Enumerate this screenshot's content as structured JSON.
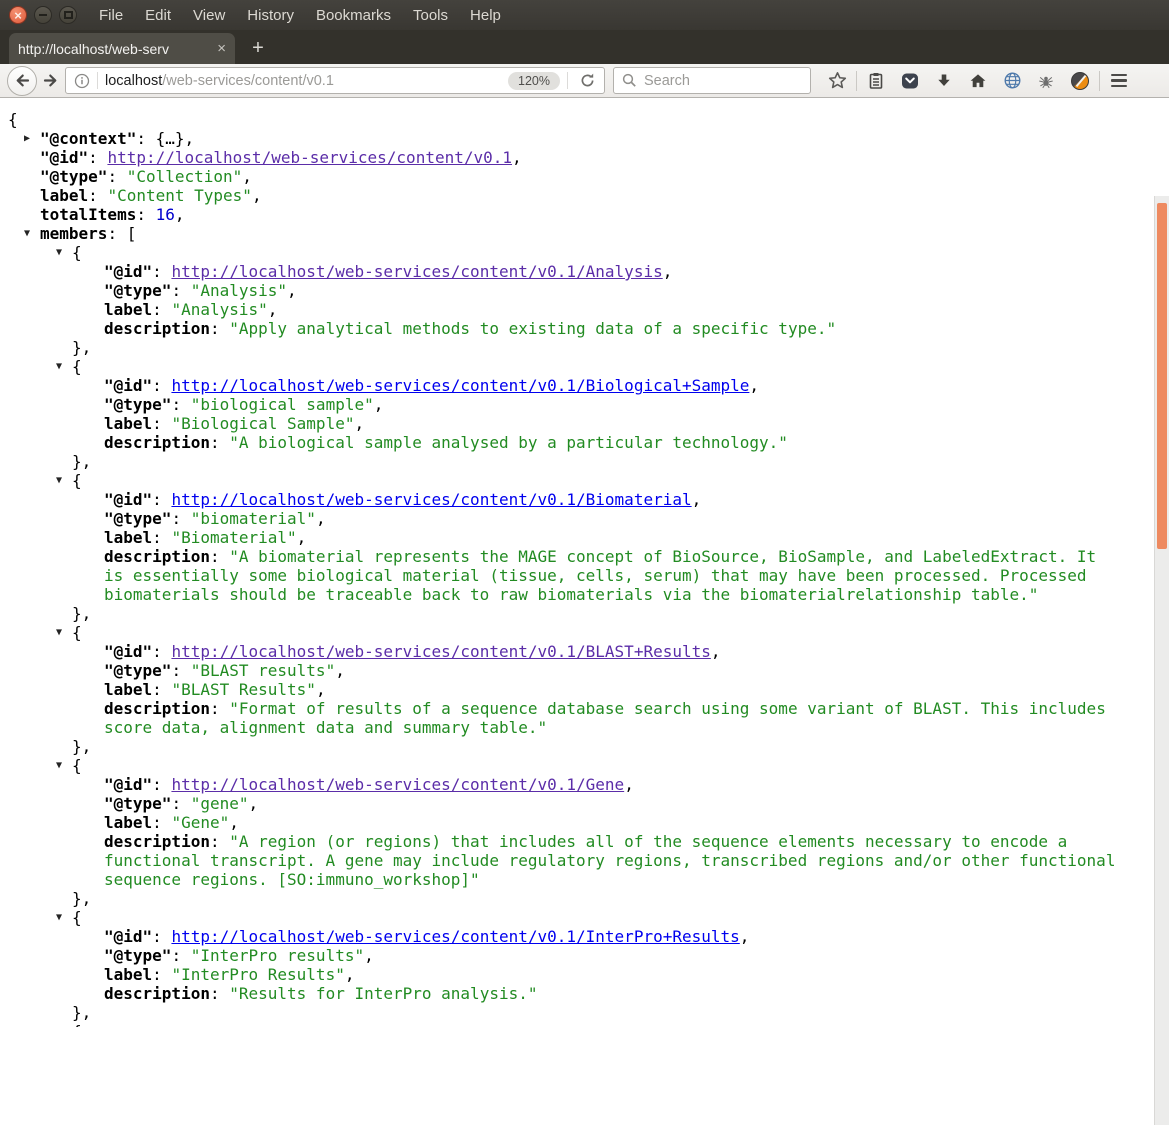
{
  "window": {
    "menus": [
      "File",
      "Edit",
      "View",
      "History",
      "Bookmarks",
      "Tools",
      "Help"
    ],
    "close_glyph": "×",
    "minimize_glyph": "−"
  },
  "tab_bar": {
    "active_tab_title": "http://localhost/web-serv",
    "tab_close_glyph": "×",
    "new_tab_glyph": "+"
  },
  "toolbar": {
    "url_host": "localhost",
    "url_path": "/web-services/content/v0.1",
    "zoom_level": "120%",
    "search_placeholder": "Search"
  },
  "colors": {
    "string_green": "#228B22",
    "link_blue": "#0000EE",
    "link_visited_purple": "#5B2DA8",
    "number_blue": "#0000CD",
    "scrollbar_orange": "#EE8A60"
  },
  "json_doc": {
    "root_open": "{",
    "array_open": "[",
    "object_open": "{",
    "object_close_comma": "},",
    "collapsed_object": "{…},",
    "colon_sep": ": ",
    "comma": ",",
    "quote": "\"",
    "entries": {
      "context_key": "@context",
      "id_key": "@id",
      "type_key": "@type",
      "label_key": "label",
      "total_items_key": "totalItems",
      "members_key": "members",
      "description_key": "description"
    },
    "root": {
      "id_href": "http://localhost/web-services/content/v0.1",
      "id_visited": true,
      "type": "Collection",
      "label": "Content Types",
      "total_items": "16"
    },
    "members": [
      {
        "id_href": "http://localhost/web-services/content/v0.1/Analysis",
        "id_visited": true,
        "type": "Analysis",
        "label": "Analysis",
        "description": "Apply analytical methods to existing data of a specific type."
      },
      {
        "id_href": "http://localhost/web-services/content/v0.1/Biological+Sample",
        "id_visited": false,
        "type": "biological sample",
        "label": "Biological Sample",
        "description": "A biological sample analysed by a particular technology."
      },
      {
        "id_href": "http://localhost/web-services/content/v0.1/Biomaterial",
        "id_visited": false,
        "type": "biomaterial",
        "label": "Biomaterial",
        "description": "A biomaterial represents the MAGE concept of BioSource, BioSample, and LabeledExtract. It is essentially some biological material (tissue, cells, serum) that may have been processed. Processed biomaterials should be traceable back to raw biomaterials via the biomaterialrelationship table."
      },
      {
        "id_href": "http://localhost/web-services/content/v0.1/BLAST+Results",
        "id_visited": true,
        "type": "BLAST results",
        "label": "BLAST Results",
        "description": "Format of results of a sequence database search using some variant of BLAST. This includes score data, alignment data and summary table."
      },
      {
        "id_href": "http://localhost/web-services/content/v0.1/Gene",
        "id_visited": true,
        "type": "gene",
        "label": "Gene",
        "description": "A region (or regions) that includes all of the sequence elements necessary to encode a functional transcript. A gene may include regulatory regions, transcribed regions and/or other functional sequence regions. [SO:immuno_workshop]"
      },
      {
        "id_href": "http://localhost/web-services/content/v0.1/InterPro+Results",
        "id_visited": false,
        "type": "InterPro results",
        "label": "InterPro Results",
        "description": "Results for InterPro analysis."
      }
    ],
    "partial_next_member": true
  }
}
